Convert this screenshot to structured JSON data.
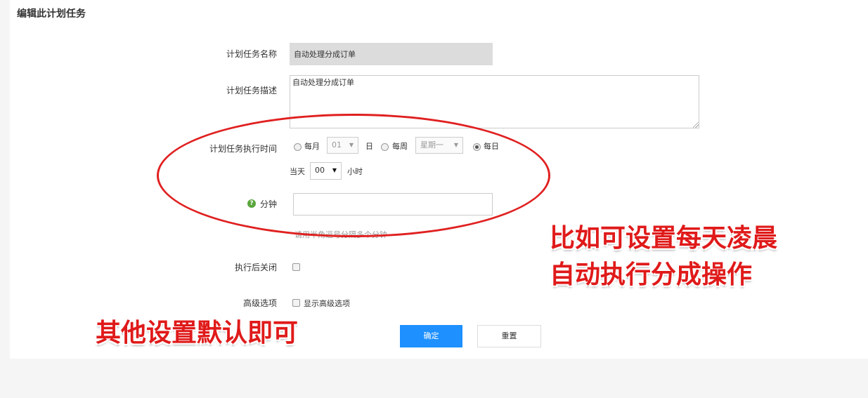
{
  "page": {
    "title": "编辑此计划任务"
  },
  "form": {
    "name": {
      "label": "计划任务名称",
      "value": "自动处理分成订单"
    },
    "description": {
      "label": "计划任务描述",
      "value": "自动处理分成订单"
    },
    "schedule": {
      "label": "计划任务执行时间",
      "monthly_label": "每月",
      "day_select": "01",
      "day_unit": "日",
      "weekly_label": "每周",
      "weekday_select": "星期一",
      "daily_label": "每日",
      "selected": "每日",
      "today_label": "当天",
      "hour_select": "00",
      "hour_unit": "小时"
    },
    "minute": {
      "label": "分钟",
      "value": "",
      "hint": "请用半角逗号分隔多个分钟"
    },
    "close_after": {
      "label": "执行后关闭",
      "checked": false
    },
    "advanced": {
      "label": "高级选项",
      "checkbox_label": "显示高级选项",
      "checked": false
    },
    "buttons": {
      "confirm": "确定",
      "reset": "重置"
    }
  },
  "annotations": {
    "callout_right_line1": "比如可设置每天凌晨",
    "callout_right_line2": "自动执行分成操作",
    "callout_left": "其他设置默认即可",
    "highlight_color": "#e02020"
  },
  "colors": {
    "primary": "#1e90ff",
    "help_icon": "#5aa63c"
  }
}
